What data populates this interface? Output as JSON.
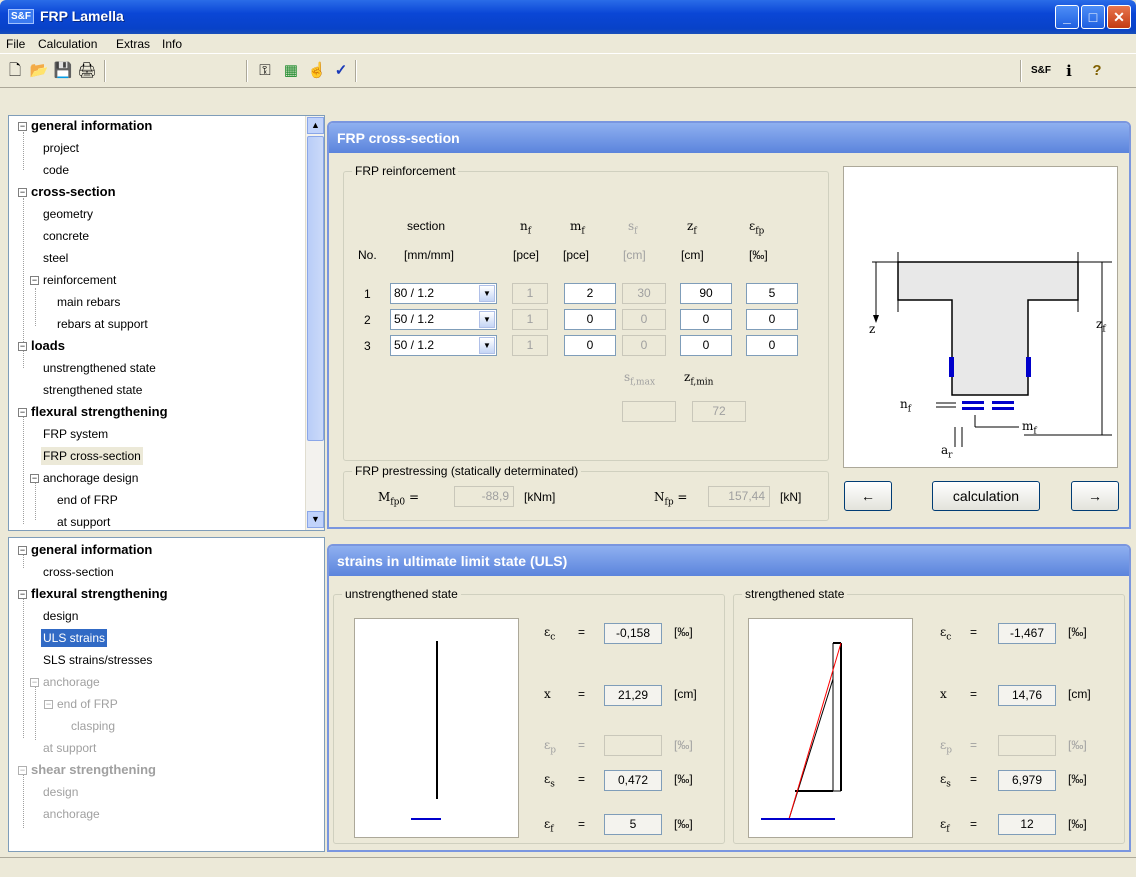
{
  "window": {
    "logo": "S&F",
    "title": "FRP Lamella",
    "min": "_",
    "max": "□",
    "close": "✕"
  },
  "menu": [
    "File",
    "Calculation",
    "Extras",
    "Info"
  ],
  "toolbar": {
    "new": "🗋",
    "open": "📂",
    "save": "💾",
    "print": "🖨",
    "key": "⚿",
    "calc": "▦",
    "hand": "☝",
    "check": "✓",
    "sf": "S&F",
    "info": "i",
    "help": "?"
  },
  "nav_top": [
    {
      "label": "general information",
      "bold": true
    },
    {
      "label": "project"
    },
    {
      "label": "code"
    },
    {
      "label": "cross-section",
      "bold": true
    },
    {
      "label": "geometry"
    },
    {
      "label": "concrete"
    },
    {
      "label": "steel"
    },
    {
      "label": "reinforcement"
    },
    {
      "label": "main rebars"
    },
    {
      "label": "rebars at support"
    },
    {
      "label": "loads",
      "bold": true
    },
    {
      "label": "unstrengthened state"
    },
    {
      "label": "strengthened state"
    },
    {
      "label": "flexural strengthening",
      "bold": true
    },
    {
      "label": "FRP system"
    },
    {
      "label": "FRP cross-section",
      "selected": true
    },
    {
      "label": "anchorage design"
    },
    {
      "label": "end of FRP"
    },
    {
      "label": "at support"
    }
  ],
  "nav_bottom": [
    {
      "label": "general information",
      "bold": true
    },
    {
      "label": "cross-section"
    },
    {
      "label": "flexural strengthening",
      "bold": true
    },
    {
      "label": "design"
    },
    {
      "label": "ULS strains",
      "selected": true
    },
    {
      "label": "SLS strains/stresses"
    },
    {
      "label": "anchorage",
      "disabled": true
    },
    {
      "label": "end of FRP",
      "disabled": true
    },
    {
      "label": "clasping",
      "disabled": true
    },
    {
      "label": "at support",
      "disabled": true
    },
    {
      "label": "shear strengthening",
      "bold": true,
      "disabled": true
    },
    {
      "label": "design",
      "disabled": true
    },
    {
      "label": "anchorage",
      "disabled": true
    }
  ],
  "cross_section": {
    "title": "FRP cross-section",
    "group_reinf": "FRP reinforcement",
    "headers": {
      "no": "No.",
      "section": "section",
      "section_unit": "[mm/mm]",
      "nf_unit": "[pce]",
      "mf_unit": "[pce]",
      "sf_unit": "[cm]",
      "zf_unit": "[cm]",
      "efp_unit": "[‰]"
    },
    "rows": [
      {
        "no": "1",
        "section": "80 / 1.2",
        "nf": "1",
        "mf": "2",
        "sf": "30",
        "zf": "90",
        "efp": "5"
      },
      {
        "no": "2",
        "section": "50 / 1.2",
        "nf": "1",
        "mf": "0",
        "sf": "0",
        "zf": "0",
        "efp": "0"
      },
      {
        "no": "3",
        "section": "50 / 1.2",
        "nf": "1",
        "mf": "0",
        "sf": "0",
        "zf": "0",
        "efp": "0"
      }
    ],
    "sfmax_value": "",
    "zfmin_value": "72",
    "group_prestress": "FRP prestressing (statically determinated)",
    "mfp0_value": "-88,9",
    "mfp0_unit": "[kNm]",
    "nfp_value": "157,44",
    "nfp_unit": "[kN]",
    "prev_button": "←",
    "calc_button": "calculation",
    "next_button": "→"
  },
  "uls": {
    "title": "strains in ultimate limit state (ULS)",
    "unstrengthened": {
      "label": "unstrengthened state",
      "ec": "-0,158",
      "x": "21,29",
      "ep": "",
      "es": "0,472",
      "ef": "5"
    },
    "strengthened": {
      "label": "strengthened state",
      "ec": "-1,467",
      "x": "14,76",
      "ep": "",
      "es": "6,979",
      "ef": "12"
    },
    "units": {
      "permille": "[‰]",
      "cm": "[cm]"
    },
    "eq": "="
  },
  "colors": {
    "title_bar": "#0a46d6",
    "panel_header": "#6f94e2",
    "selection": "#316ac5",
    "frp": "#0000cc",
    "strain_line": "#ff0000"
  }
}
